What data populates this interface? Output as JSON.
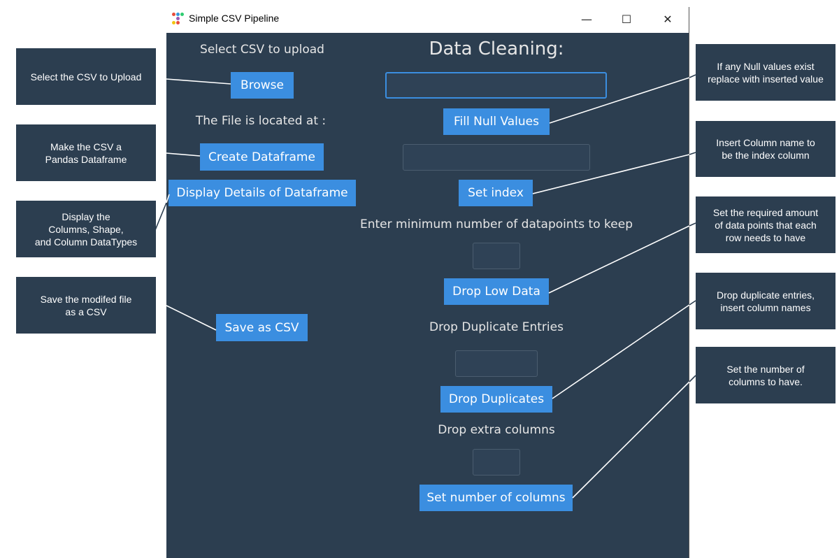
{
  "window": {
    "title": "Simple CSV Pipeline",
    "minimize_glyph": "—",
    "maximize_glyph": "☐",
    "close_glyph": "✕"
  },
  "left": {
    "select_label": "Select CSV to upload",
    "browse": "Browse",
    "file_located": "The File is located at :",
    "create_df": "Create Dataframe",
    "display_details": "Display Details of Dataframe",
    "save_csv": "Save as CSV"
  },
  "right": {
    "heading": "Data Cleaning:",
    "fill_null": "Fill Null Values",
    "set_index": "Set index",
    "min_points_label": "Enter minimum number of datapoints to keep",
    "drop_low": "Drop Low Data",
    "drop_dup_label": "Drop Duplicate Entries",
    "drop_duplicates": "Drop Duplicates",
    "drop_extra_label": "Drop extra columns",
    "set_num_cols": "Set number of columns"
  },
  "annotations": {
    "left": [
      "Select the CSV to Upload",
      "Make the CSV a\nPandas Dataframe",
      "Display the\nColumns, Shape,\nand Column DataTypes",
      "Save the modifed file\nas a CSV"
    ],
    "right": [
      "If any Null values exist\nreplace with inserted value",
      "Insert Column name to\nbe the index column",
      "Set the required amount\nof data points that each\nrow needs to have",
      "Drop duplicate entries,\ninsert column names",
      "Set the number of\ncolumns to have."
    ]
  },
  "colors": {
    "panel": "#2c3e50",
    "button": "#3b8ee0",
    "entry": "#2f4256"
  }
}
